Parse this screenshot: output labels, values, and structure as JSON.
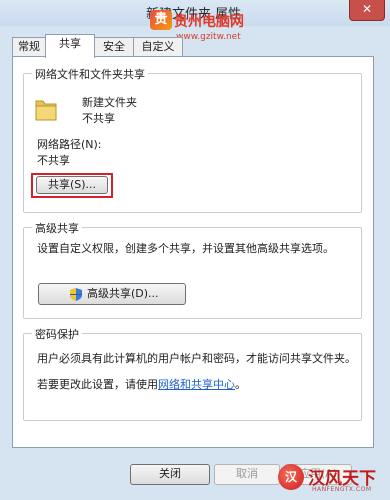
{
  "window": {
    "title": "新建文件夹 属性",
    "close_glyph": "✕"
  },
  "watermark_top": {
    "logo_glyph": "贵",
    "brand": "贵州电脑网",
    "url": "www.gzitw.net"
  },
  "tabs": [
    {
      "label": "常规",
      "active": false
    },
    {
      "label": "共享",
      "active": true
    },
    {
      "label": "安全",
      "active": false
    },
    {
      "label": "自定义",
      "active": false
    }
  ],
  "network_sharing": {
    "legend": "网络文件和文件夹共享",
    "folder_name": "新建文件夹",
    "folder_status": "不共享",
    "path_label": "网络路径(N):",
    "path_value": "不共享",
    "share_button": "共享(S)..."
  },
  "advanced_sharing": {
    "legend": "高级共享",
    "description": "设置自定义权限，创建多个共享，并设置其他高级共享选项。",
    "button": "高级共享(D)..."
  },
  "password_protection": {
    "legend": "密码保护",
    "line1": "用户必须具有此计算机的用户帐户和密码，才能访问共享文件夹。",
    "line2_prefix": "若要更改此设置，请使用",
    "link": "网络和共享中心",
    "line2_suffix": "。"
  },
  "footer": {
    "close_button": "关闭",
    "cancel_button": "取消",
    "apply_button": "应用(A)"
  },
  "watermark_bottom": {
    "logo_glyph": "汉",
    "brand": "汉风天下",
    "sub": "HANFENGTX.COM"
  },
  "colors": {
    "highlight": "#d0232a",
    "link": "#1d5fcc",
    "window_bg": "#d6e3f1"
  }
}
